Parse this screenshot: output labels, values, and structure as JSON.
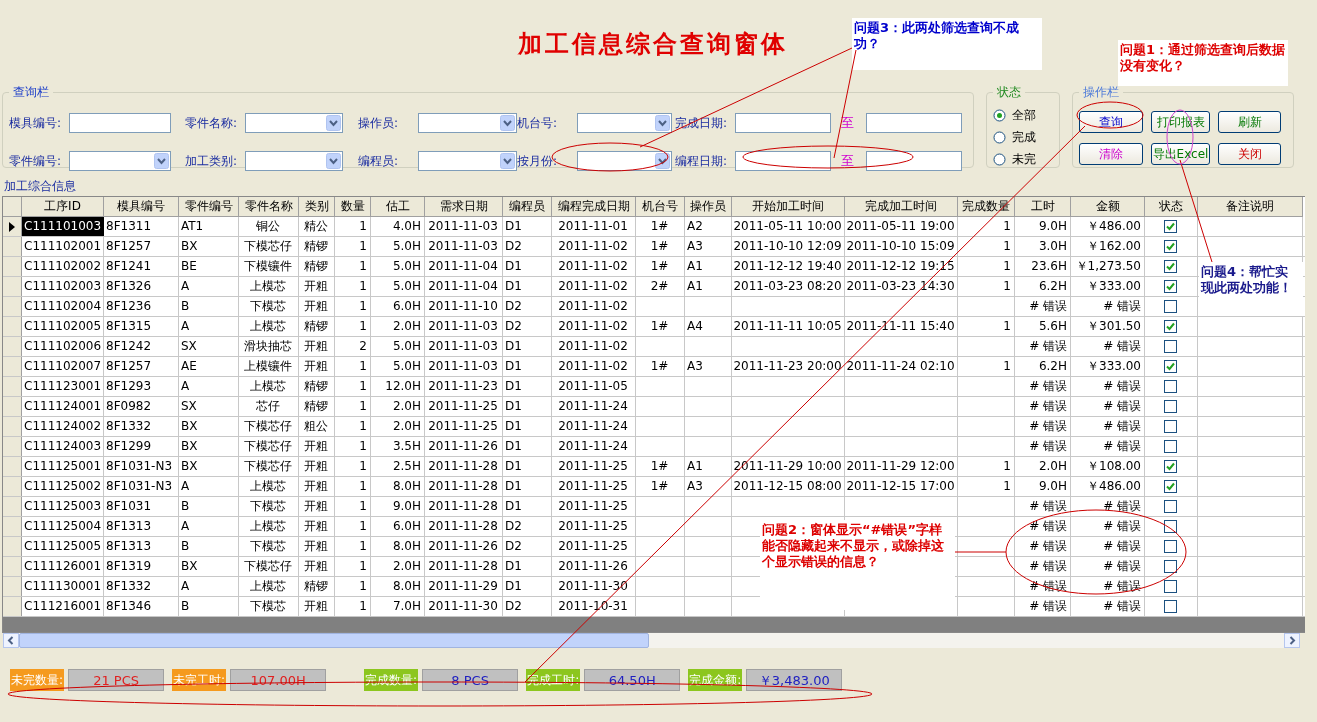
{
  "title": "加工信息综合查询窗体",
  "query": {
    "legend": "查询栏",
    "rows": [
      [
        {
          "label": "模具编号:",
          "kind": "text"
        },
        {
          "label": "零件名称:",
          "kind": "combo"
        },
        {
          "label": "操作员:",
          "kind": "combo"
        },
        {
          "label": "机台号:",
          "kind": "combo"
        },
        {
          "label": "完成日期:",
          "kind": "range",
          "separator": "至"
        }
      ],
      [
        {
          "label": "零件编号:",
          "kind": "combo"
        },
        {
          "label": "加工类别:",
          "kind": "combo"
        },
        {
          "label": "编程员:",
          "kind": "combo"
        },
        {
          "label": "按月份:",
          "kind": "combo"
        },
        {
          "label": "编程日期:",
          "kind": "range",
          "separator": "至"
        }
      ]
    ]
  },
  "status": {
    "legend": "状态",
    "options": [
      {
        "label": "全部",
        "selected": true
      },
      {
        "label": "完成",
        "selected": false
      },
      {
        "label": "未完",
        "selected": false
      }
    ]
  },
  "actions": {
    "legend": "操作栏",
    "buttons": [
      {
        "label": "查询"
      },
      {
        "label": "打印报表"
      },
      {
        "label": "刷新"
      },
      {
        "label": "清除"
      },
      {
        "label": "导出Excel"
      },
      {
        "label": "关闭"
      }
    ]
  },
  "section_label": "加工综合信息",
  "table": {
    "columns": [
      "工序ID",
      "模具编号",
      "零件编号",
      "零件名称",
      "类别",
      "数量",
      "估工",
      "需求日期",
      "编程员",
      "编程完成日期",
      "机台号",
      "操作员",
      "开始加工时间",
      "完成加工时间",
      "完成数量",
      "工时",
      "金额",
      "状态",
      "备注说明"
    ],
    "rows": [
      {
        "selected": true,
        "checked": true,
        "id": "C111101003",
        "mold": "8F1311",
        "part": "AT1",
        "name": "铜公",
        "type": "精公",
        "qty": "1",
        "est": "4.0H",
        "due": "2011-11-03",
        "prog": "D1",
        "prog_date": "2011-11-01",
        "machine": "1#",
        "oper": "A2",
        "start": "2011-05-11 10:00",
        "end": "2011-05-11 19:00",
        "done_qty": "1",
        "hours": "9.0H",
        "amount": "￥486.00"
      },
      {
        "selected": false,
        "checked": true,
        "id": "C111102001",
        "mold": "8F1257",
        "part": "BX",
        "name": "下模芯仔",
        "type": "精锣",
        "qty": "1",
        "est": "5.0H",
        "due": "2011-11-03",
        "prog": "D2",
        "prog_date": "2011-11-02",
        "machine": "1#",
        "oper": "A3",
        "start": "2011-10-10 12:09",
        "end": "2011-10-10 15:09",
        "done_qty": "1",
        "hours": "3.0H",
        "amount": "￥162.00"
      },
      {
        "selected": false,
        "checked": true,
        "id": "C111102002",
        "mold": "8F1241",
        "part": "BE",
        "name": "下模镶件",
        "type": "精锣",
        "qty": "1",
        "est": "5.0H",
        "due": "2011-11-04",
        "prog": "D1",
        "prog_date": "2011-11-02",
        "machine": "1#",
        "oper": "A1",
        "start": "2011-12-12 19:40",
        "end": "2011-12-12 19:15",
        "done_qty": "1",
        "hours": "23.6H",
        "amount": "￥1,273.50"
      },
      {
        "selected": false,
        "checked": true,
        "id": "C111102003",
        "mold": "8F1326",
        "part": "A",
        "name": "上模芯",
        "type": "开粗",
        "qty": "1",
        "est": "5.0H",
        "due": "2011-11-04",
        "prog": "D1",
        "prog_date": "2011-11-02",
        "machine": "2#",
        "oper": "A1",
        "start": "2011-03-23 08:20",
        "end": "2011-03-23 14:30",
        "done_qty": "1",
        "hours": "6.2H",
        "amount": "￥333.00"
      },
      {
        "selected": false,
        "checked": false,
        "id": "C111102004",
        "mold": "8F1236",
        "part": "B",
        "name": "下模芯",
        "type": "开粗",
        "qty": "1",
        "est": "6.0H",
        "due": "2011-11-10",
        "prog": "D2",
        "prog_date": "2011-11-02",
        "hours": "# 错误",
        "amount": "# 错误"
      },
      {
        "selected": false,
        "checked": true,
        "id": "C111102005",
        "mold": "8F1315",
        "part": "A",
        "name": "上模芯",
        "type": "精锣",
        "qty": "1",
        "est": "2.0H",
        "due": "2011-11-03",
        "prog": "D2",
        "prog_date": "2011-11-02",
        "machine": "1#",
        "oper": "A4",
        "start": "2011-11-11 10:05",
        "end": "2011-11-11 15:40",
        "done_qty": "1",
        "hours": "5.6H",
        "amount": "￥301.50"
      },
      {
        "selected": false,
        "checked": false,
        "id": "C111102006",
        "mold": "8F1242",
        "part": "SX",
        "name": "滑块抽芯",
        "type": "开粗",
        "qty": "2",
        "est": "5.0H",
        "due": "2011-11-03",
        "prog": "D1",
        "prog_date": "2011-11-02",
        "hours": "# 错误",
        "amount": "# 错误"
      },
      {
        "selected": false,
        "checked": true,
        "id": "C111102007",
        "mold": "8F1257",
        "part": "AE",
        "name": "上模镶件",
        "type": "开粗",
        "qty": "1",
        "est": "5.0H",
        "due": "2011-11-03",
        "prog": "D1",
        "prog_date": "2011-11-02",
        "machine": "1#",
        "oper": "A3",
        "start": "2011-11-23 20:00",
        "end": "2011-11-24 02:10",
        "done_qty": "1",
        "hours": "6.2H",
        "amount": "￥333.00"
      },
      {
        "selected": false,
        "checked": false,
        "id": "C111123001",
        "mold": "8F1293",
        "part": "A",
        "name": "上模芯",
        "type": "精锣",
        "qty": "1",
        "est": "12.0H",
        "due": "2011-11-23",
        "prog": "D1",
        "prog_date": "2011-11-05",
        "hours": "# 错误",
        "amount": "# 错误"
      },
      {
        "selected": false,
        "checked": false,
        "id": "C111124001",
        "mold": "8F0982",
        "part": "SX",
        "name": "芯仔",
        "type": "精锣",
        "qty": "1",
        "est": "2.0H",
        "due": "2011-11-25",
        "prog": "D1",
        "prog_date": "2011-11-24",
        "hours": "# 错误",
        "amount": "# 错误"
      },
      {
        "selected": false,
        "checked": false,
        "id": "C111124002",
        "mold": "8F1332",
        "part": "BX",
        "name": "下模芯仔",
        "type": "粗公",
        "qty": "1",
        "est": "2.0H",
        "due": "2011-11-25",
        "prog": "D1",
        "prog_date": "2011-11-24",
        "hours": "# 错误",
        "amount": "# 错误"
      },
      {
        "selected": false,
        "checked": false,
        "id": "C111124003",
        "mold": "8F1299",
        "part": "BX",
        "name": "下模芯仔",
        "type": "开粗",
        "qty": "1",
        "est": "3.5H",
        "due": "2011-11-26",
        "prog": "D1",
        "prog_date": "2011-11-24",
        "hours": "# 错误",
        "amount": "# 错误"
      },
      {
        "selected": false,
        "checked": true,
        "id": "C111125001",
        "mold": "8F1031-N3",
        "part": "BX",
        "name": "下模芯仔",
        "type": "开粗",
        "qty": "1",
        "est": "2.5H",
        "due": "2011-11-28",
        "prog": "D1",
        "prog_date": "2011-11-25",
        "machine": "1#",
        "oper": "A1",
        "start": "2011-11-29 10:00",
        "end": "2011-11-29 12:00",
        "done_qty": "1",
        "hours": "2.0H",
        "amount": "￥108.00"
      },
      {
        "selected": false,
        "checked": true,
        "id": "C111125002",
        "mold": "8F1031-N3",
        "part": "A",
        "name": "上模芯",
        "type": "开粗",
        "qty": "1",
        "est": "8.0H",
        "due": "2011-11-28",
        "prog": "D1",
        "prog_date": "2011-11-25",
        "machine": "1#",
        "oper": "A3",
        "start": "2011-12-15 08:00",
        "end": "2011-12-15 17:00",
        "done_qty": "1",
        "hours": "9.0H",
        "amount": "￥486.00"
      },
      {
        "selected": false,
        "checked": false,
        "id": "C111125003",
        "mold": "8F1031",
        "part": "B",
        "name": "下模芯",
        "type": "开粗",
        "qty": "1",
        "est": "9.0H",
        "due": "2011-11-28",
        "prog": "D1",
        "prog_date": "2011-11-25",
        "hours": "# 错误",
        "amount": "# 错误"
      },
      {
        "selected": false,
        "checked": false,
        "id": "C111125004",
        "mold": "8F1313",
        "part": "A",
        "name": "上模芯",
        "type": "开粗",
        "qty": "1",
        "est": "6.0H",
        "due": "2011-11-28",
        "prog": "D2",
        "prog_date": "2011-11-25",
        "hours": "# 错误",
        "amount": "# 错误"
      },
      {
        "selected": false,
        "checked": false,
        "id": "C111125005",
        "mold": "8F1313",
        "part": "B",
        "name": "下模芯",
        "type": "开粗",
        "qty": "1",
        "est": "8.0H",
        "due": "2011-11-26",
        "prog": "D2",
        "prog_date": "2011-11-25",
        "hours": "# 错误",
        "amount": "# 错误"
      },
      {
        "selected": false,
        "checked": false,
        "id": "C111126001",
        "mold": "8F1319",
        "part": "BX",
        "name": "下模芯仔",
        "type": "开粗",
        "qty": "1",
        "est": "2.0H",
        "due": "2011-11-28",
        "prog": "D1",
        "prog_date": "2011-11-26",
        "hours": "# 错误",
        "amount": "# 错误"
      },
      {
        "selected": false,
        "checked": false,
        "id": "C111130001",
        "mold": "8F1332",
        "part": "A",
        "name": "上模芯",
        "type": "精锣",
        "qty": "1",
        "est": "8.0H",
        "due": "2011-11-29",
        "prog": "D1",
        "prog_date": "2011-11-30",
        "hours": "# 错误",
        "amount": "# 错误"
      },
      {
        "selected": false,
        "checked": false,
        "id": "C111216001",
        "mold": "8F1346",
        "part": "B",
        "name": "下模芯",
        "type": "开粗",
        "qty": "1",
        "est": "7.0H",
        "due": "2011-11-30",
        "prog": "D2",
        "prog_date": "2011-10-31",
        "hours": "# 错误",
        "amount": "# 错误"
      }
    ]
  },
  "summary": [
    {
      "label": "未完数量:",
      "value": "21 PCS",
      "kind": "pending"
    },
    {
      "label": "未完工时:",
      "value": "107.00H",
      "kind": "pending"
    },
    {
      "label": "完成数量:",
      "value": "8 PCS",
      "kind": "done"
    },
    {
      "label": "完成工时:",
      "value": "64.50H",
      "kind": "done"
    },
    {
      "label": "完成金额:",
      "value": "￥3,483.00",
      "kind": "done"
    }
  ],
  "annotations": [
    {
      "text": "问题3：此两处筛选查询不成功？",
      "color": "#0000cc"
    },
    {
      "text": "问题1：通过筛选查询后数据没有变化？",
      "color": "#dd0000"
    },
    {
      "text": "问题4：帮忙实现此两处功能！",
      "color": "#1a1a8c"
    },
    {
      "text": "问题2：窗体显示“#错误”字样能否隐藏起来不显示，或除掉这个显示错误的信息？",
      "color": "#dd0000"
    }
  ]
}
